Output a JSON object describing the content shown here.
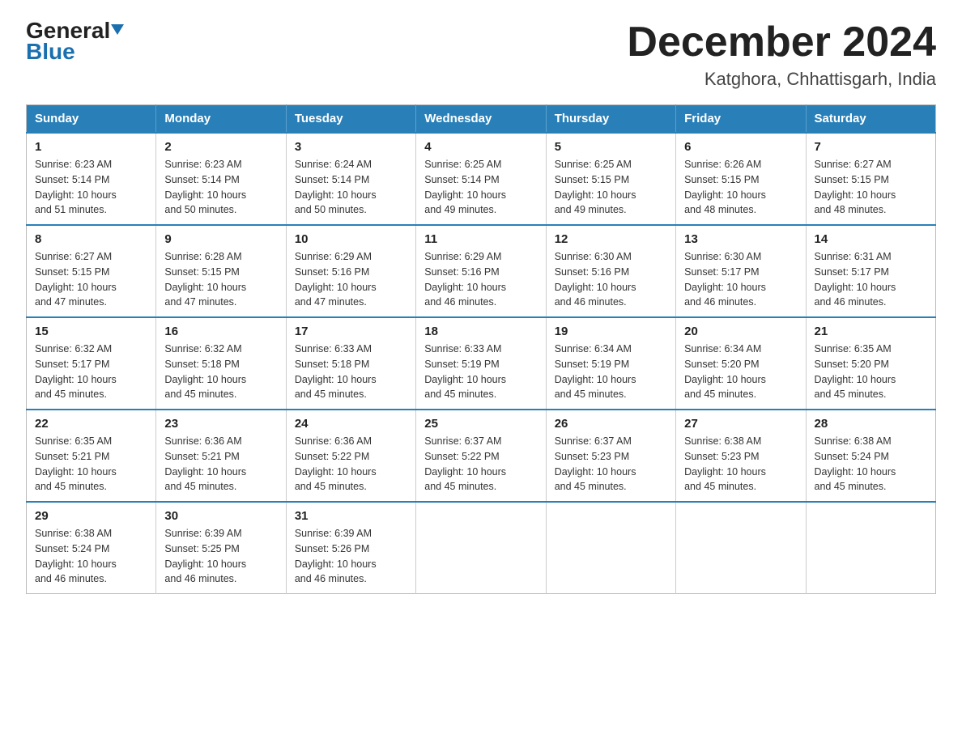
{
  "header": {
    "logo_top": "General",
    "logo_bottom": "Blue",
    "title": "December 2024",
    "subtitle": "Katghora, Chhattisgarh, India"
  },
  "days_of_week": [
    "Sunday",
    "Monday",
    "Tuesday",
    "Wednesday",
    "Thursday",
    "Friday",
    "Saturday"
  ],
  "weeks": [
    [
      {
        "num": "1",
        "sunrise": "6:23 AM",
        "sunset": "5:14 PM",
        "daylight": "10 hours and 51 minutes."
      },
      {
        "num": "2",
        "sunrise": "6:23 AM",
        "sunset": "5:14 PM",
        "daylight": "10 hours and 50 minutes."
      },
      {
        "num": "3",
        "sunrise": "6:24 AM",
        "sunset": "5:14 PM",
        "daylight": "10 hours and 50 minutes."
      },
      {
        "num": "4",
        "sunrise": "6:25 AM",
        "sunset": "5:14 PM",
        "daylight": "10 hours and 49 minutes."
      },
      {
        "num": "5",
        "sunrise": "6:25 AM",
        "sunset": "5:15 PM",
        "daylight": "10 hours and 49 minutes."
      },
      {
        "num": "6",
        "sunrise": "6:26 AM",
        "sunset": "5:15 PM",
        "daylight": "10 hours and 48 minutes."
      },
      {
        "num": "7",
        "sunrise": "6:27 AM",
        "sunset": "5:15 PM",
        "daylight": "10 hours and 48 minutes."
      }
    ],
    [
      {
        "num": "8",
        "sunrise": "6:27 AM",
        "sunset": "5:15 PM",
        "daylight": "10 hours and 47 minutes."
      },
      {
        "num": "9",
        "sunrise": "6:28 AM",
        "sunset": "5:15 PM",
        "daylight": "10 hours and 47 minutes."
      },
      {
        "num": "10",
        "sunrise": "6:29 AM",
        "sunset": "5:16 PM",
        "daylight": "10 hours and 47 minutes."
      },
      {
        "num": "11",
        "sunrise": "6:29 AM",
        "sunset": "5:16 PM",
        "daylight": "10 hours and 46 minutes."
      },
      {
        "num": "12",
        "sunrise": "6:30 AM",
        "sunset": "5:16 PM",
        "daylight": "10 hours and 46 minutes."
      },
      {
        "num": "13",
        "sunrise": "6:30 AM",
        "sunset": "5:17 PM",
        "daylight": "10 hours and 46 minutes."
      },
      {
        "num": "14",
        "sunrise": "6:31 AM",
        "sunset": "5:17 PM",
        "daylight": "10 hours and 46 minutes."
      }
    ],
    [
      {
        "num": "15",
        "sunrise": "6:32 AM",
        "sunset": "5:17 PM",
        "daylight": "10 hours and 45 minutes."
      },
      {
        "num": "16",
        "sunrise": "6:32 AM",
        "sunset": "5:18 PM",
        "daylight": "10 hours and 45 minutes."
      },
      {
        "num": "17",
        "sunrise": "6:33 AM",
        "sunset": "5:18 PM",
        "daylight": "10 hours and 45 minutes."
      },
      {
        "num": "18",
        "sunrise": "6:33 AM",
        "sunset": "5:19 PM",
        "daylight": "10 hours and 45 minutes."
      },
      {
        "num": "19",
        "sunrise": "6:34 AM",
        "sunset": "5:19 PM",
        "daylight": "10 hours and 45 minutes."
      },
      {
        "num": "20",
        "sunrise": "6:34 AM",
        "sunset": "5:20 PM",
        "daylight": "10 hours and 45 minutes."
      },
      {
        "num": "21",
        "sunrise": "6:35 AM",
        "sunset": "5:20 PM",
        "daylight": "10 hours and 45 minutes."
      }
    ],
    [
      {
        "num": "22",
        "sunrise": "6:35 AM",
        "sunset": "5:21 PM",
        "daylight": "10 hours and 45 minutes."
      },
      {
        "num": "23",
        "sunrise": "6:36 AM",
        "sunset": "5:21 PM",
        "daylight": "10 hours and 45 minutes."
      },
      {
        "num": "24",
        "sunrise": "6:36 AM",
        "sunset": "5:22 PM",
        "daylight": "10 hours and 45 minutes."
      },
      {
        "num": "25",
        "sunrise": "6:37 AM",
        "sunset": "5:22 PM",
        "daylight": "10 hours and 45 minutes."
      },
      {
        "num": "26",
        "sunrise": "6:37 AM",
        "sunset": "5:23 PM",
        "daylight": "10 hours and 45 minutes."
      },
      {
        "num": "27",
        "sunrise": "6:38 AM",
        "sunset": "5:23 PM",
        "daylight": "10 hours and 45 minutes."
      },
      {
        "num": "28",
        "sunrise": "6:38 AM",
        "sunset": "5:24 PM",
        "daylight": "10 hours and 45 minutes."
      }
    ],
    [
      {
        "num": "29",
        "sunrise": "6:38 AM",
        "sunset": "5:24 PM",
        "daylight": "10 hours and 46 minutes."
      },
      {
        "num": "30",
        "sunrise": "6:39 AM",
        "sunset": "5:25 PM",
        "daylight": "10 hours and 46 minutes."
      },
      {
        "num": "31",
        "sunrise": "6:39 AM",
        "sunset": "5:26 PM",
        "daylight": "10 hours and 46 minutes."
      },
      null,
      null,
      null,
      null
    ]
  ],
  "labels": {
    "sunrise": "Sunrise:",
    "sunset": "Sunset:",
    "daylight": "Daylight:"
  }
}
